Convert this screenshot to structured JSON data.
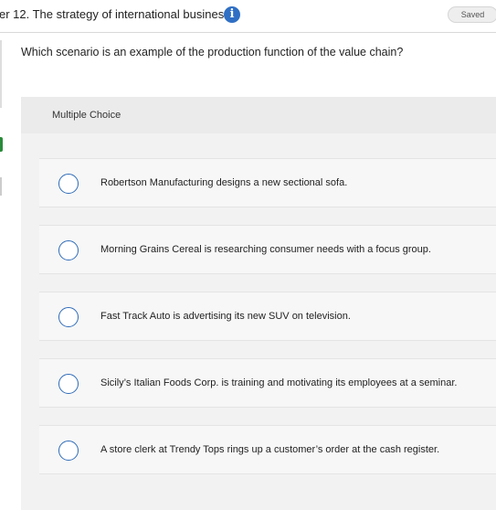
{
  "header": {
    "title": "er 12. The strategy of international business",
    "info_glyph": "i",
    "saved_label": "Saved"
  },
  "question": {
    "text": "Which scenario is an example of the production function of the value chain?"
  },
  "multiple_choice": {
    "label": "Multiple Choice",
    "options": [
      {
        "text": "Robertson Manufacturing designs a new sectional sofa."
      },
      {
        "text": "Morning Grains Cereal is researching consumer needs with a focus group."
      },
      {
        "text": "Fast Track Auto is advertising its new SUV on television."
      },
      {
        "text": "Sicily’s Italian Foods Corp. is training and motivating its employees at a seminar."
      },
      {
        "text": "A store clerk at Trendy Tops rings up a customer’s order at the cash register."
      }
    ]
  },
  "colors": {
    "accent": "#2e6bb8",
    "info_icon": "#2f6fc4",
    "panel_bg": "#f2f2f2",
    "option_bg": "#f7f7f7",
    "side_indicator": "#2a8a3a"
  }
}
